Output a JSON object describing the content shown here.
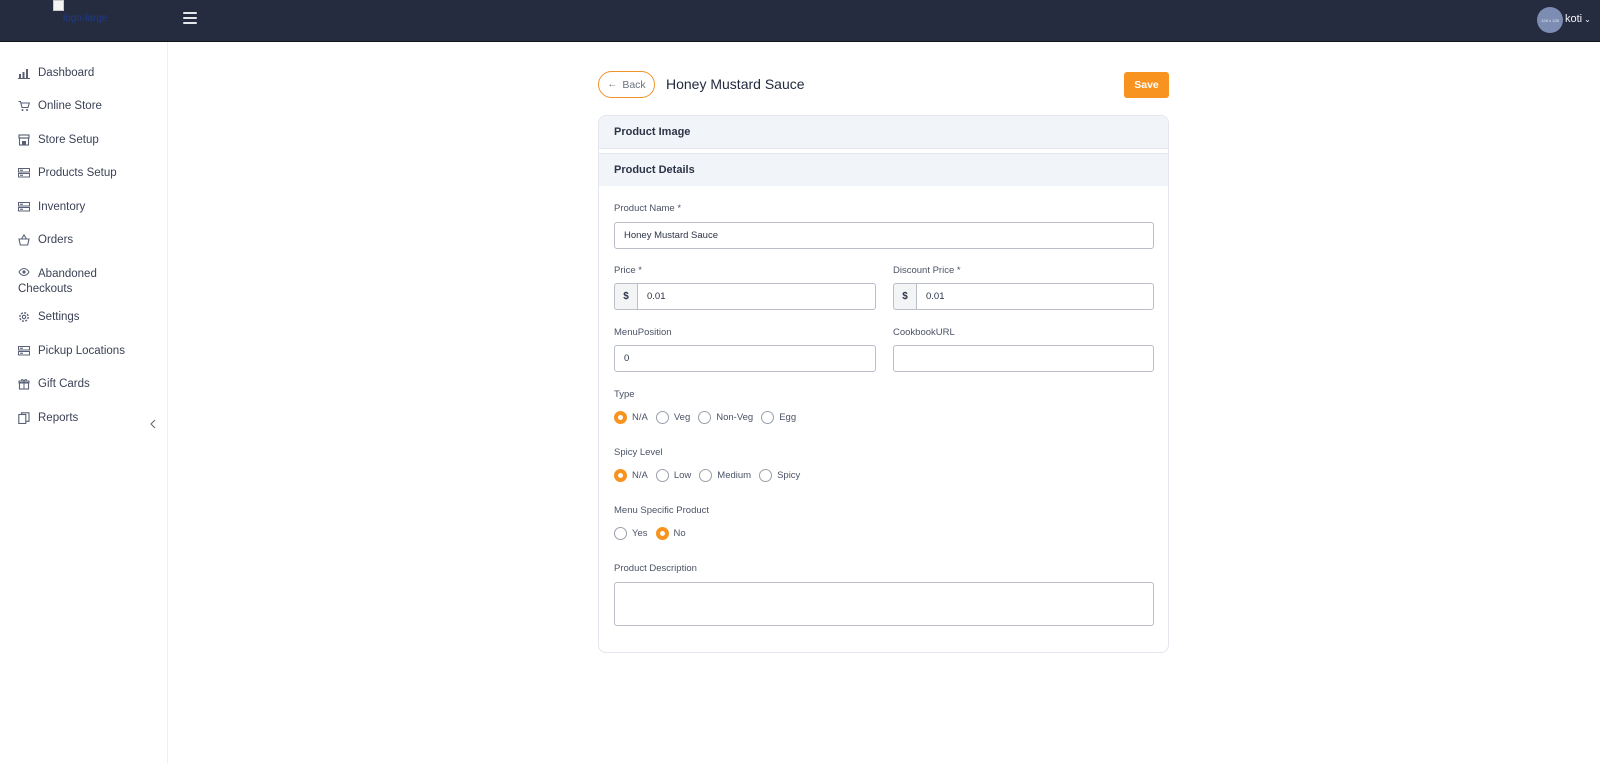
{
  "topbar": {
    "logo_alt": "logo-large",
    "avatar_text": "128 x 128",
    "username": "koti"
  },
  "sidebar": {
    "items": [
      {
        "label": "Dashboard",
        "icon": "bar-chart-icon"
      },
      {
        "label": "Online Store",
        "icon": "cart-icon"
      },
      {
        "label": "Store Setup",
        "icon": "storefront-icon"
      },
      {
        "label": "Products Setup",
        "icon": "list-icon"
      },
      {
        "label": "Inventory",
        "icon": "list-icon"
      },
      {
        "label": "Orders",
        "icon": "basket-icon"
      },
      {
        "label": "Abandoned Checkouts",
        "icon": "eye-icon"
      },
      {
        "label": "Settings",
        "icon": "gear-icon"
      },
      {
        "label": "Pickup Locations",
        "icon": "list-icon"
      },
      {
        "label": "Gift Cards",
        "icon": "gift-icon"
      },
      {
        "label": "Reports",
        "icon": "copy-icon"
      }
    ]
  },
  "header": {
    "back_label": "Back",
    "title": "Honey Mustard Sauce",
    "save_label": "Save"
  },
  "sections": {
    "product_image": "Product Image",
    "product_details": "Product Details"
  },
  "form": {
    "product_name": {
      "label": "Product Name *",
      "value": "Honey Mustard Sauce"
    },
    "price": {
      "label": "Price *",
      "prefix": "$",
      "value": "0.01"
    },
    "discount_price": {
      "label": "Discount Price *",
      "prefix": "$",
      "value": "0.01"
    },
    "menu_position": {
      "label": "MenuPosition",
      "value": "0"
    },
    "cookbook_url": {
      "label": "CookbookURL",
      "value": ""
    },
    "type": {
      "label": "Type",
      "options": [
        "N/A",
        "Veg",
        "Non-Veg",
        "Egg"
      ],
      "selected": "N/A"
    },
    "spicy_level": {
      "label": "Spicy Level",
      "options": [
        "N/A",
        "Low",
        "Medium",
        "Spicy"
      ],
      "selected": "N/A"
    },
    "menu_specific": {
      "label": "Menu Specific Product",
      "options": [
        "Yes",
        "No"
      ],
      "selected": "No"
    },
    "description": {
      "label": "Product Description",
      "value": ""
    }
  },
  "colors": {
    "topbar": "#262c3f",
    "accent": "#f7931e"
  }
}
